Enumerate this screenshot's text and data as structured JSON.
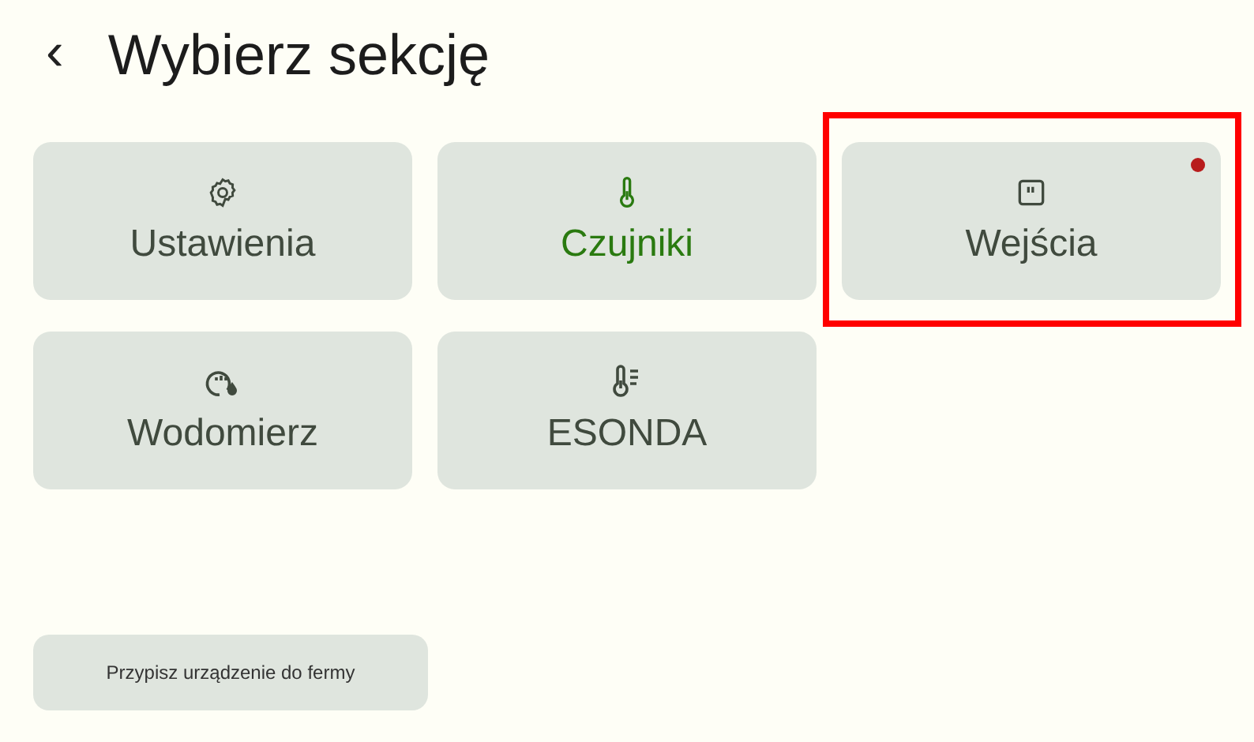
{
  "header": {
    "back": "‹",
    "title": "Wybierz sekcję"
  },
  "sections": [
    {
      "label": "Ustawienia",
      "kind": "gear",
      "selected": false,
      "alert": false,
      "highlighted": false
    },
    {
      "label": "Czujniki",
      "kind": "thermometer",
      "selected": true,
      "alert": false,
      "highlighted": false
    },
    {
      "label": "Wejścia",
      "kind": "input",
      "selected": false,
      "alert": true,
      "highlighted": true
    },
    {
      "label": "Wodomierz",
      "kind": "meter",
      "selected": false,
      "alert": false,
      "highlighted": false
    },
    {
      "label": "ESONDA",
      "kind": "probe",
      "selected": false,
      "alert": false,
      "highlighted": false
    }
  ],
  "assign_button": "Przypisz urządzenie do fermy"
}
